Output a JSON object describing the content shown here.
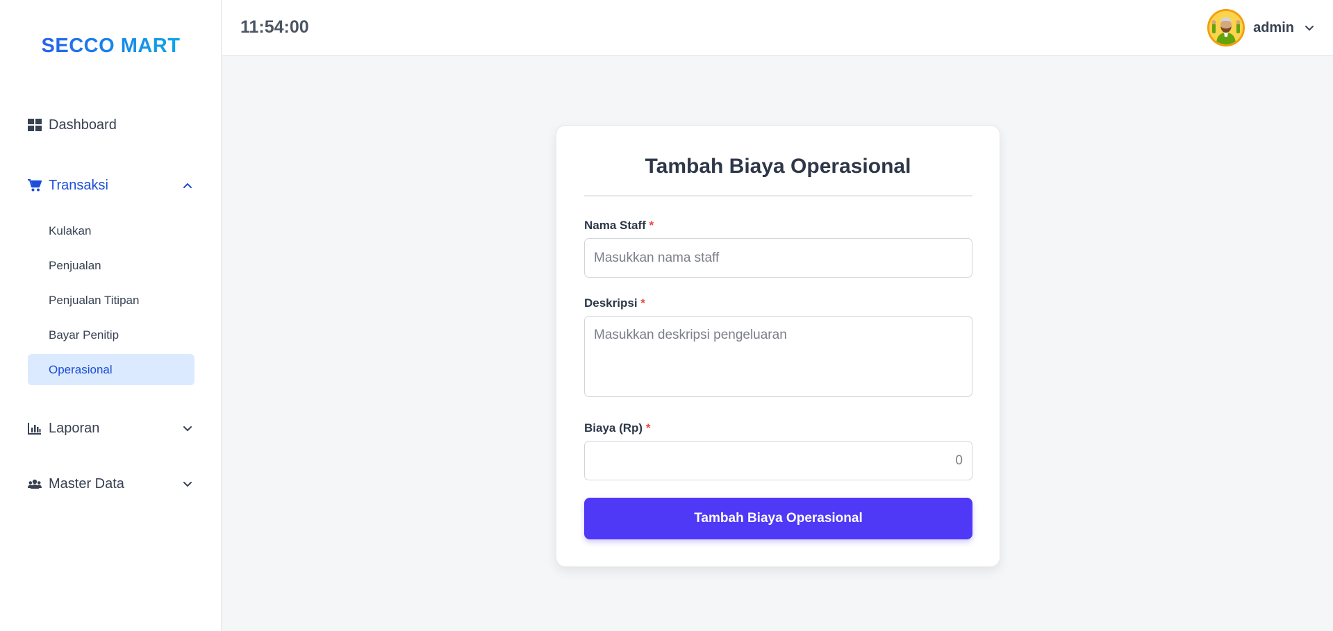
{
  "brand": "SECCO MART",
  "header": {
    "clock": "11:54:00",
    "user_name": "admin"
  },
  "sidebar": {
    "dashboard": "Dashboard",
    "transaksi": "Transaksi",
    "transaksi_items": [
      "Kulakan",
      "Penjualan",
      "Penjualan Titipan",
      "Bayar Penitip",
      "Operasional"
    ],
    "laporan": "Laporan",
    "master_data": "Master Data"
  },
  "form": {
    "title": "Tambah Biaya Operasional",
    "nama_staff_label": "Nama Staff",
    "nama_staff_placeholder": "Masukkan nama staff",
    "deskripsi_label": "Deskripsi",
    "deskripsi_placeholder": "Masukkan deskripsi pengeluaran",
    "biaya_label": "Biaya (Rp)",
    "biaya_placeholder": "0",
    "required_marker": "*",
    "submit_label": "Tambah Biaya Operasional"
  },
  "colors": {
    "accent": "#4f39f6",
    "active_nav": "#1d4ed8",
    "selected_bg": "#dbeafe",
    "required": "#ef4444"
  }
}
